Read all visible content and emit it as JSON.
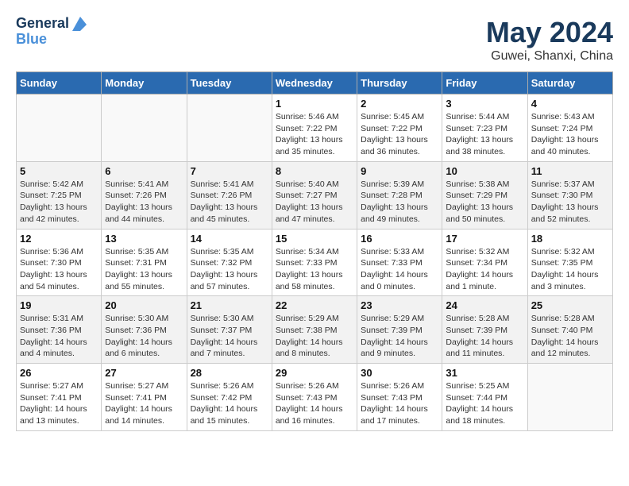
{
  "header": {
    "logo_line1": "General",
    "logo_line2": "Blue",
    "month": "May 2024",
    "location": "Guwei, Shanxi, China"
  },
  "weekdays": [
    "Sunday",
    "Monday",
    "Tuesday",
    "Wednesday",
    "Thursday",
    "Friday",
    "Saturday"
  ],
  "weeks": [
    [
      {
        "day": "",
        "sunrise": "",
        "sunset": "",
        "daylight": ""
      },
      {
        "day": "",
        "sunrise": "",
        "sunset": "",
        "daylight": ""
      },
      {
        "day": "",
        "sunrise": "",
        "sunset": "",
        "daylight": ""
      },
      {
        "day": "1",
        "sunrise": "Sunrise: 5:46 AM",
        "sunset": "Sunset: 7:22 PM",
        "daylight": "Daylight: 13 hours and 35 minutes."
      },
      {
        "day": "2",
        "sunrise": "Sunrise: 5:45 AM",
        "sunset": "Sunset: 7:22 PM",
        "daylight": "Daylight: 13 hours and 36 minutes."
      },
      {
        "day": "3",
        "sunrise": "Sunrise: 5:44 AM",
        "sunset": "Sunset: 7:23 PM",
        "daylight": "Daylight: 13 hours and 38 minutes."
      },
      {
        "day": "4",
        "sunrise": "Sunrise: 5:43 AM",
        "sunset": "Sunset: 7:24 PM",
        "daylight": "Daylight: 13 hours and 40 minutes."
      }
    ],
    [
      {
        "day": "5",
        "sunrise": "Sunrise: 5:42 AM",
        "sunset": "Sunset: 7:25 PM",
        "daylight": "Daylight: 13 hours and 42 minutes."
      },
      {
        "day": "6",
        "sunrise": "Sunrise: 5:41 AM",
        "sunset": "Sunset: 7:26 PM",
        "daylight": "Daylight: 13 hours and 44 minutes."
      },
      {
        "day": "7",
        "sunrise": "Sunrise: 5:41 AM",
        "sunset": "Sunset: 7:26 PM",
        "daylight": "Daylight: 13 hours and 45 minutes."
      },
      {
        "day": "8",
        "sunrise": "Sunrise: 5:40 AM",
        "sunset": "Sunset: 7:27 PM",
        "daylight": "Daylight: 13 hours and 47 minutes."
      },
      {
        "day": "9",
        "sunrise": "Sunrise: 5:39 AM",
        "sunset": "Sunset: 7:28 PM",
        "daylight": "Daylight: 13 hours and 49 minutes."
      },
      {
        "day": "10",
        "sunrise": "Sunrise: 5:38 AM",
        "sunset": "Sunset: 7:29 PM",
        "daylight": "Daylight: 13 hours and 50 minutes."
      },
      {
        "day": "11",
        "sunrise": "Sunrise: 5:37 AM",
        "sunset": "Sunset: 7:30 PM",
        "daylight": "Daylight: 13 hours and 52 minutes."
      }
    ],
    [
      {
        "day": "12",
        "sunrise": "Sunrise: 5:36 AM",
        "sunset": "Sunset: 7:30 PM",
        "daylight": "Daylight: 13 hours and 54 minutes."
      },
      {
        "day": "13",
        "sunrise": "Sunrise: 5:35 AM",
        "sunset": "Sunset: 7:31 PM",
        "daylight": "Daylight: 13 hours and 55 minutes."
      },
      {
        "day": "14",
        "sunrise": "Sunrise: 5:35 AM",
        "sunset": "Sunset: 7:32 PM",
        "daylight": "Daylight: 13 hours and 57 minutes."
      },
      {
        "day": "15",
        "sunrise": "Sunrise: 5:34 AM",
        "sunset": "Sunset: 7:33 PM",
        "daylight": "Daylight: 13 hours and 58 minutes."
      },
      {
        "day": "16",
        "sunrise": "Sunrise: 5:33 AM",
        "sunset": "Sunset: 7:33 PM",
        "daylight": "Daylight: 14 hours and 0 minutes."
      },
      {
        "day": "17",
        "sunrise": "Sunrise: 5:32 AM",
        "sunset": "Sunset: 7:34 PM",
        "daylight": "Daylight: 14 hours and 1 minute."
      },
      {
        "day": "18",
        "sunrise": "Sunrise: 5:32 AM",
        "sunset": "Sunset: 7:35 PM",
        "daylight": "Daylight: 14 hours and 3 minutes."
      }
    ],
    [
      {
        "day": "19",
        "sunrise": "Sunrise: 5:31 AM",
        "sunset": "Sunset: 7:36 PM",
        "daylight": "Daylight: 14 hours and 4 minutes."
      },
      {
        "day": "20",
        "sunrise": "Sunrise: 5:30 AM",
        "sunset": "Sunset: 7:36 PM",
        "daylight": "Daylight: 14 hours and 6 minutes."
      },
      {
        "day": "21",
        "sunrise": "Sunrise: 5:30 AM",
        "sunset": "Sunset: 7:37 PM",
        "daylight": "Daylight: 14 hours and 7 minutes."
      },
      {
        "day": "22",
        "sunrise": "Sunrise: 5:29 AM",
        "sunset": "Sunset: 7:38 PM",
        "daylight": "Daylight: 14 hours and 8 minutes."
      },
      {
        "day": "23",
        "sunrise": "Sunrise: 5:29 AM",
        "sunset": "Sunset: 7:39 PM",
        "daylight": "Daylight: 14 hours and 9 minutes."
      },
      {
        "day": "24",
        "sunrise": "Sunrise: 5:28 AM",
        "sunset": "Sunset: 7:39 PM",
        "daylight": "Daylight: 14 hours and 11 minutes."
      },
      {
        "day": "25",
        "sunrise": "Sunrise: 5:28 AM",
        "sunset": "Sunset: 7:40 PM",
        "daylight": "Daylight: 14 hours and 12 minutes."
      }
    ],
    [
      {
        "day": "26",
        "sunrise": "Sunrise: 5:27 AM",
        "sunset": "Sunset: 7:41 PM",
        "daylight": "Daylight: 14 hours and 13 minutes."
      },
      {
        "day": "27",
        "sunrise": "Sunrise: 5:27 AM",
        "sunset": "Sunset: 7:41 PM",
        "daylight": "Daylight: 14 hours and 14 minutes."
      },
      {
        "day": "28",
        "sunrise": "Sunrise: 5:26 AM",
        "sunset": "Sunset: 7:42 PM",
        "daylight": "Daylight: 14 hours and 15 minutes."
      },
      {
        "day": "29",
        "sunrise": "Sunrise: 5:26 AM",
        "sunset": "Sunset: 7:43 PM",
        "daylight": "Daylight: 14 hours and 16 minutes."
      },
      {
        "day": "30",
        "sunrise": "Sunrise: 5:26 AM",
        "sunset": "Sunset: 7:43 PM",
        "daylight": "Daylight: 14 hours and 17 minutes."
      },
      {
        "day": "31",
        "sunrise": "Sunrise: 5:25 AM",
        "sunset": "Sunset: 7:44 PM",
        "daylight": "Daylight: 14 hours and 18 minutes."
      },
      {
        "day": "",
        "sunrise": "",
        "sunset": "",
        "daylight": ""
      }
    ]
  ]
}
